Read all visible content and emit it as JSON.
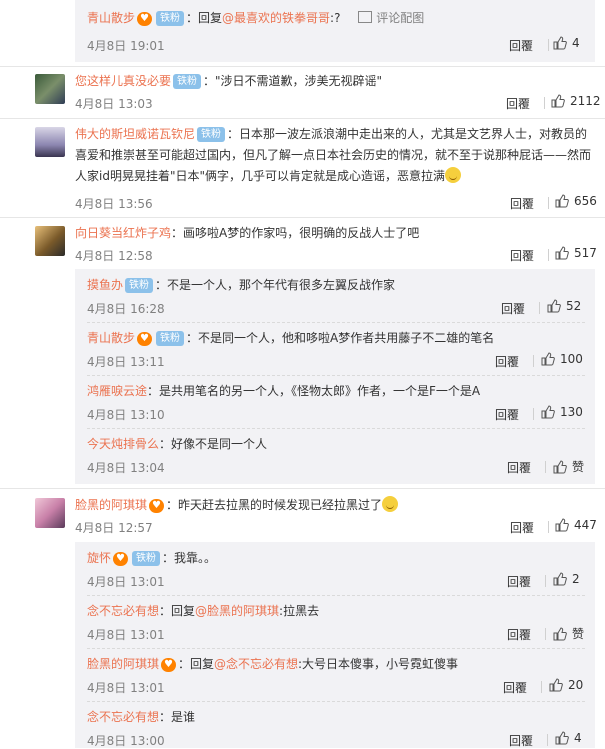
{
  "top_subreply": {
    "user": "青山散步",
    "badge": "铁粉",
    "reply_prefix": "回复",
    "mention": "@最喜欢的铁拳哥哥",
    "suffix": ":?",
    "pic_link": "评论配图",
    "time": "4月8日 19:01",
    "reply": "回覆",
    "likes": "4"
  },
  "comments": [
    {
      "user": "您这样儿真没必要",
      "badge": "铁粉",
      "text": "：\"涉日不需道歉，涉美无视辟谣\"",
      "time": "4月8日 13:03",
      "reply": "回覆",
      "likes": "2112"
    },
    {
      "user": "伟大的斯坦威诺瓦钦尼",
      "badge": "铁粉",
      "text": "：日本那一波左派浪潮中走出来的人，尤其是文艺界人士，对教员的喜爱和推崇甚至可能超过国内，但凡了解一点日本社会历史的情况，就不至于说那种屁话——然而人家id明晃晃挂着\"日本\"俩字，几乎可以肯定就是成心造谣，恶意拉满",
      "time": "4月8日 13:56",
      "reply": "回覆",
      "likes": "656"
    },
    {
      "user": "向日葵当红炸子鸡",
      "text": "：画哆啦A梦的作家吗，很明确的反战人士了吧",
      "time": "4月8日 12:58",
      "reply": "回覆",
      "likes": "517",
      "subs": [
        {
          "user": "摸鱼办",
          "badge": "铁粉",
          "text": "：不是一个人，那个年代有很多左翼反战作家",
          "time": "4月8日 16:28",
          "reply": "回覆",
          "likes": "52"
        },
        {
          "user": "青山散步",
          "badge": "铁粉",
          "text": "：不是同一个人，他和哆啦A梦作者共用藤子不二雄的笔名",
          "time": "4月8日 13:11",
          "reply": "回覆",
          "likes": "100"
        },
        {
          "user": "鸿雁唳云途",
          "text": "：是共用笔名的另一个人，《怪物太郎》作者，一个是F一个是A",
          "time": "4月8日 13:10",
          "reply": "回覆",
          "likes": "130"
        },
        {
          "user": "今天炖排骨么",
          "text": "：好像不是同一个人",
          "time": "4月8日 13:04",
          "reply": "回覆",
          "likes": "赞"
        }
      ]
    },
    {
      "user": "脸黑的阿琪琪",
      "text": "：昨天赶去拉黑的时候发现已经拉黑过了",
      "time": "4月8日 12:57",
      "reply": "回覆",
      "likes": "447",
      "subs": [
        {
          "user": "旋怀",
          "badge": "铁粉",
          "text": "：我靠。。",
          "time": "4月8日 13:01",
          "reply": "回覆",
          "likes": "2"
        },
        {
          "user": "念不忘必有想",
          "reply_prefix": "：回复",
          "mention": "@脸黑的阿琪琪",
          "text": ":拉黑去",
          "time": "4月8日 13:01",
          "reply": "回覆",
          "likes": "赞"
        },
        {
          "user": "脸黑的阿琪琪",
          "reply_prefix": "：回复",
          "mention": "@念不忘必有想",
          "text": ":大号日本傻事，小号霓虹傻事",
          "time": "4月8日 13:01",
          "reply": "回覆",
          "likes": "20"
        },
        {
          "user": "念不忘必有想",
          "text": "：是谁",
          "time": "4月8日 13:00",
          "reply": "回覆",
          "likes": "4"
        }
      ]
    }
  ],
  "colors": {
    "username": "#eb7350",
    "fan_badge": "#8cc1ea",
    "sub_bg": "#f2f2f5"
  }
}
